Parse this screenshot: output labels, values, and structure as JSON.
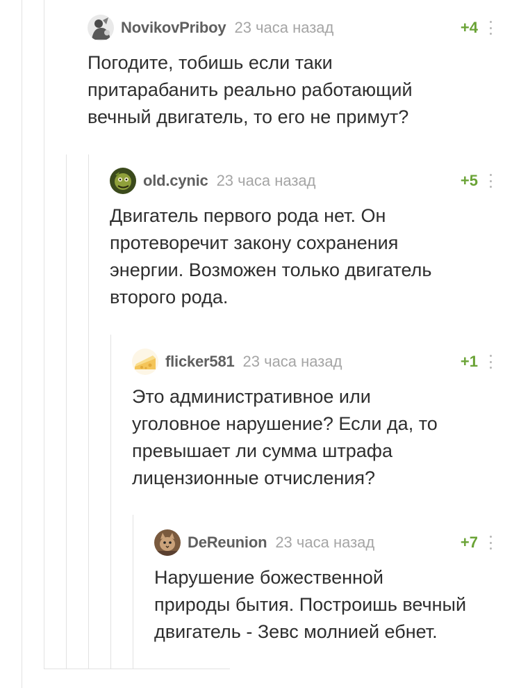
{
  "comments": [
    {
      "username": "NovikovPriboy",
      "timestamp": "23 часа назад",
      "rating": "+4",
      "text": "Погодите, тобишь если таки\nпритарабанить реально работающий\nвечный двигатель, то его не примут?",
      "avatar_icon": "user-avatar-figure"
    },
    {
      "username": "old.cynic",
      "timestamp": "23 часа назад",
      "rating": "+5",
      "text": "Двигатель первого рода нет. Он\nпротеворечит закону сохранения\nэнергии. Возможен только двигатель\nвторого рода.",
      "avatar_icon": "user-avatar-green-creature"
    },
    {
      "username": "flicker581",
      "timestamp": "23 часа назад",
      "rating": "+1",
      "text": "Это административное или\nуголовное нарушение? Если да, то\nпревышает ли сумма штрафа\nлицензионные отчисления?",
      "avatar_icon": "user-avatar-cheese"
    },
    {
      "username": "DeReunion",
      "timestamp": "23 часа назад",
      "rating": "+7",
      "text": "Нарушение божественной\nприроды бытия. Построишь вечный\nдвигатель - Зевс молнией ебнет.",
      "avatar_icon": "user-avatar-cat"
    }
  ],
  "colors": {
    "rating": "#6aa336",
    "username": "#5f5f5f",
    "timestamp": "#a5a5a5",
    "thread_line": "#e2e2e2"
  }
}
